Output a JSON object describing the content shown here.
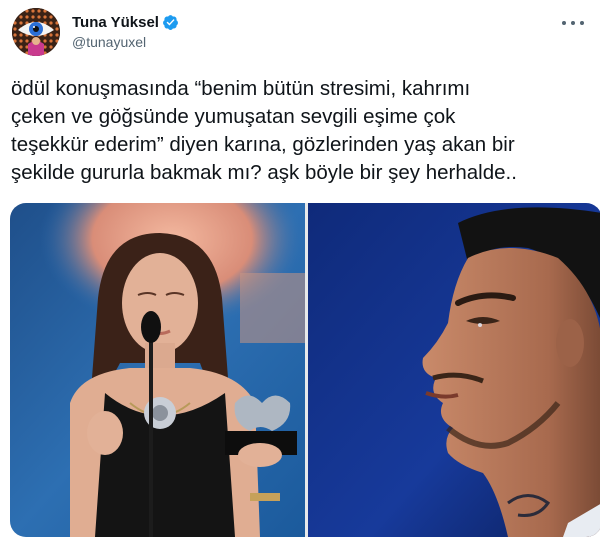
{
  "author": {
    "display_name": "Tuna Yüksel",
    "handle": "@tunayuxel",
    "verified": true,
    "avatar_icon": "eye-icon"
  },
  "tweet": {
    "lines": [
      "ödül konuşmasında “benim bütün stresimi, kahrımı",
      "çeken ve göğsünde yumuşatan sevgili eşime çok",
      "teşekkür ederim” diyen karına, gözlerinden yaş akan bir",
      "şekilde gururla bakmak mı? aşk böyle bir şey herhalde.."
    ]
  },
  "media": {
    "photos": [
      {
        "description_icon": "photo-woman-award-icon"
      },
      {
        "description_icon": "photo-man-profile-icon"
      }
    ]
  },
  "colors": {
    "verified": "#1d9bf0",
    "text": "#0f1419",
    "secondary": "#536471"
  }
}
